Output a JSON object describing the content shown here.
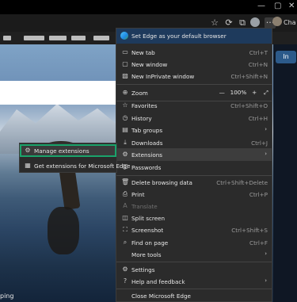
{
  "browser": {
    "toolbar_icons": [
      "star-icon",
      "refresh-icon",
      "collections-icon",
      "profile-icon",
      "more-icon"
    ],
    "more_label": "···"
  },
  "window_controls": {
    "minimize": "—",
    "maximize": "▢",
    "close": "✕"
  },
  "page": {
    "right_pill": "In",
    "chat_label": "Cha",
    "bottom_text": "ping"
  },
  "menu": {
    "banner": "Set Edge as your default browser",
    "items": [
      {
        "icon": "new-tab-icon",
        "label": "New tab",
        "shortcut": "Ctrl+T"
      },
      {
        "icon": "new-window-icon",
        "label": "New window",
        "shortcut": "Ctrl+N"
      },
      {
        "icon": "inprivate-icon",
        "label": "New InPrivate window",
        "shortcut": "Ctrl+Shift+N"
      },
      {
        "icon": "zoom-icon",
        "label": "Zoom",
        "zoom_minus": "—",
        "zoom_value": "100%",
        "zoom_plus": "+",
        "zoom_expand": "⤢"
      },
      {
        "icon": "favorites-icon",
        "label": "Favorites",
        "shortcut": "Ctrl+Shift+O"
      },
      {
        "icon": "history-icon",
        "label": "History",
        "shortcut": "Ctrl+H"
      },
      {
        "icon": "tab-groups-icon",
        "label": "Tab groups",
        "arrow": "›"
      },
      {
        "icon": "downloads-icon",
        "label": "Downloads",
        "shortcut": "Ctrl+J"
      },
      {
        "icon": "extensions-icon",
        "label": "Extensions",
        "arrow": "›"
      },
      {
        "icon": "passwords-icon",
        "label": "Passwords"
      },
      {
        "icon": "delete-icon",
        "label": "Delete browsing data",
        "shortcut": "Ctrl+Shift+Delete"
      },
      {
        "icon": "print-icon",
        "label": "Print",
        "shortcut": "Ctrl+P"
      },
      {
        "icon": "translate-icon",
        "label": "Translate"
      },
      {
        "icon": "split-screen-icon",
        "label": "Split screen"
      },
      {
        "icon": "screenshot-icon",
        "label": "Screenshot",
        "shortcut": "Ctrl+Shift+S"
      },
      {
        "icon": "find-icon",
        "label": "Find on page",
        "shortcut": "Ctrl+F"
      },
      {
        "icon": "more-tools-icon",
        "label": "More tools",
        "arrow": "›"
      },
      {
        "icon": "settings-icon",
        "label": "Settings"
      },
      {
        "icon": "help-icon",
        "label": "Help and feedback",
        "arrow": "›"
      },
      {
        "label": "Close Microsoft Edge"
      }
    ]
  },
  "submenu": {
    "items": [
      {
        "icon": "gear-icon",
        "label": "Manage extensions"
      },
      {
        "icon": "store-icon",
        "label": "Get extensions for Microsoft Edge"
      }
    ]
  },
  "colors": {
    "highlight_outline": "#1aa36b",
    "banner_bg": "#1e3a5c",
    "menu_bg": "#2b2b2b"
  }
}
